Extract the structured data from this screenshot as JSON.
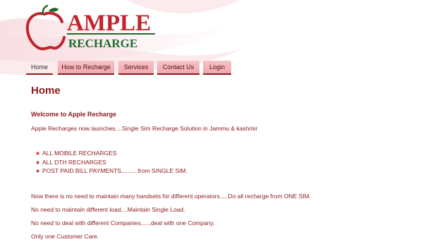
{
  "header": {
    "logo": {
      "word1": "AMPLE",
      "word2": "RECHARGE",
      "brand_red": "#c0242c",
      "brand_green": "#1f6b2b"
    }
  },
  "nav": {
    "items": [
      {
        "label": "Home"
      },
      {
        "label": "How to Recharge"
      },
      {
        "label": "Services"
      },
      {
        "label": "Contact Us"
      },
      {
        "label": "Login"
      }
    ]
  },
  "main": {
    "title": "Home",
    "welcome": "Welcome to Apple Recharge",
    "intro": "Apple Recharges now launches....Single Sim Recharge Solution in Jammu & kashmir",
    "bullets": [
      "ALL MOBILE RECHARGES",
      "ALL DTH RECHARGES",
      "POST PAID BILL PAYMENTS..........from SINGLE SIM."
    ],
    "paragraphs": [
      "Now there is no need to maintain many handsets for different operators.....Do all recharge from ONE SIM.",
      "No need to maintain different load....Maintain Single Load.",
      "No need to deal with different Companies......deal with one Company.",
      "Only one Customer Care."
    ]
  },
  "colors": {
    "accent": "#8b1a1a",
    "tab_pink": "#f0a7b0",
    "bullet_star": "#c0242c"
  }
}
